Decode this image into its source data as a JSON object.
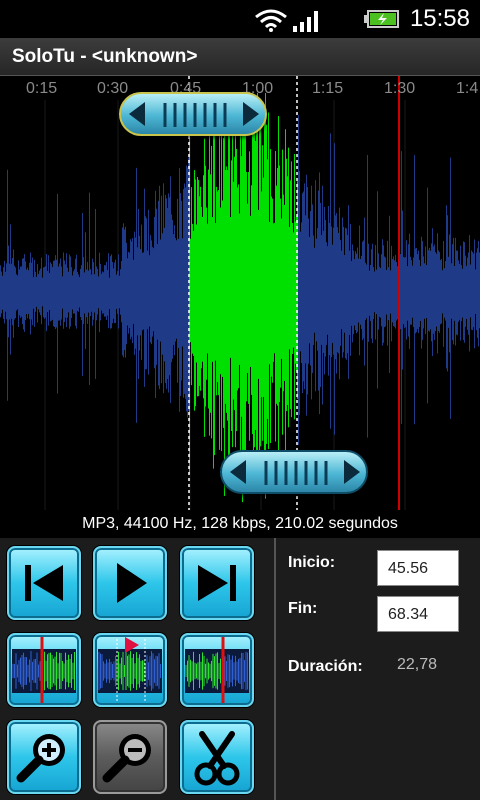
{
  "status_bar": {
    "time": "15:58",
    "icons": [
      "wifi-icon",
      "signal-icon",
      "battery-charging-icon"
    ]
  },
  "app": {
    "title": "SoloTu - <unknown>"
  },
  "timeline": {
    "ticks": [
      "0:15",
      "0:30",
      "0:45",
      "1:00",
      "1:15",
      "1:30",
      "1:4"
    ]
  },
  "file_info": "MP3, 44100 Hz, 128 kbps, 210.02 segundos",
  "colors": {
    "waveform": "#1f3a86",
    "selection": "#00e000",
    "playhead": "#d00000",
    "accent": "#2ec6ea"
  },
  "controls": {
    "row1": [
      "skip-to-start-icon",
      "play-icon",
      "skip-to-end-icon"
    ],
    "row2": [
      "set-start-marker-icon",
      "play-selection-icon",
      "set-end-marker-icon"
    ],
    "row3": [
      "zoom-in-icon",
      "zoom-out-icon",
      "cut-icon"
    ]
  },
  "selection": {
    "start_label": "Inicio:",
    "start_value": "45.56",
    "end_label": "Fin:",
    "end_value": "68.34",
    "duration_label": "Duración:",
    "duration_value": "22,78"
  }
}
